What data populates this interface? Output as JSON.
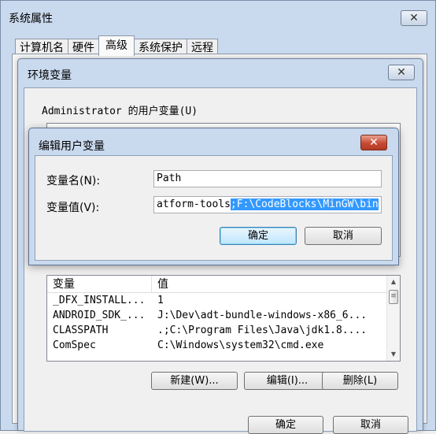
{
  "outer": {
    "title": "系统属性",
    "tabs": [
      "计算机名",
      "硬件",
      "高级",
      "系统保护",
      "远程"
    ],
    "active_tab": "高级"
  },
  "env": {
    "title": "环境变量",
    "user_vars_label": "Administrator 的用户变量(U)",
    "sys_list": {
      "headers": [
        "变量",
        "值"
      ],
      "rows": [
        {
          "name": "_DFX_INSTALL...",
          "value": "1"
        },
        {
          "name": "ANDROID_SDK_...",
          "value": "J:\\Dev\\adt-bundle-windows-x86_6..."
        },
        {
          "name": "CLASSPATH",
          "value": ".;C:\\Program Files\\Java\\jdk1.8...."
        },
        {
          "name": "ComSpec",
          "value": "C:\\Windows\\system32\\cmd.exe"
        }
      ]
    },
    "buttons": {
      "new": "新建(W)...",
      "edit": "编辑(I)...",
      "delete": "删除(L)"
    },
    "ok": "确定",
    "cancel": "取消"
  },
  "edit": {
    "title": "编辑用户变量",
    "name_label": "变量名(N):",
    "name_value": "Path",
    "value_label": "变量值(V):",
    "value_prefix": "atform-tools",
    "value_selected": ";F:\\CodeBlocks\\MinGW\\bin",
    "ok": "确定",
    "cancel": "取消"
  },
  "icons": {
    "close": "close-icon",
    "scroll_up": "scroll-up-icon",
    "scroll_down": "scroll-down-icon"
  }
}
